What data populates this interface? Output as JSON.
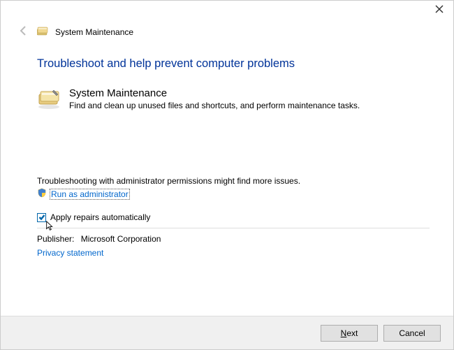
{
  "window": {
    "title": "System Maintenance"
  },
  "page": {
    "heading": "Troubleshoot and help prevent computer problems",
    "module_title": "System Maintenance",
    "module_desc": "Find and clean up unused files and shortcuts, and perform maintenance tasks."
  },
  "admin": {
    "hint": "Troubleshooting with administrator permissions might find more issues.",
    "link": "Run as administrator"
  },
  "checkbox": {
    "label": "Apply repairs automatically",
    "checked": true
  },
  "publisher": {
    "label": "Publisher:",
    "value": "Microsoft Corporation"
  },
  "privacy": {
    "link": "Privacy statement"
  },
  "buttons": {
    "next": "Next",
    "cancel": "Cancel"
  }
}
